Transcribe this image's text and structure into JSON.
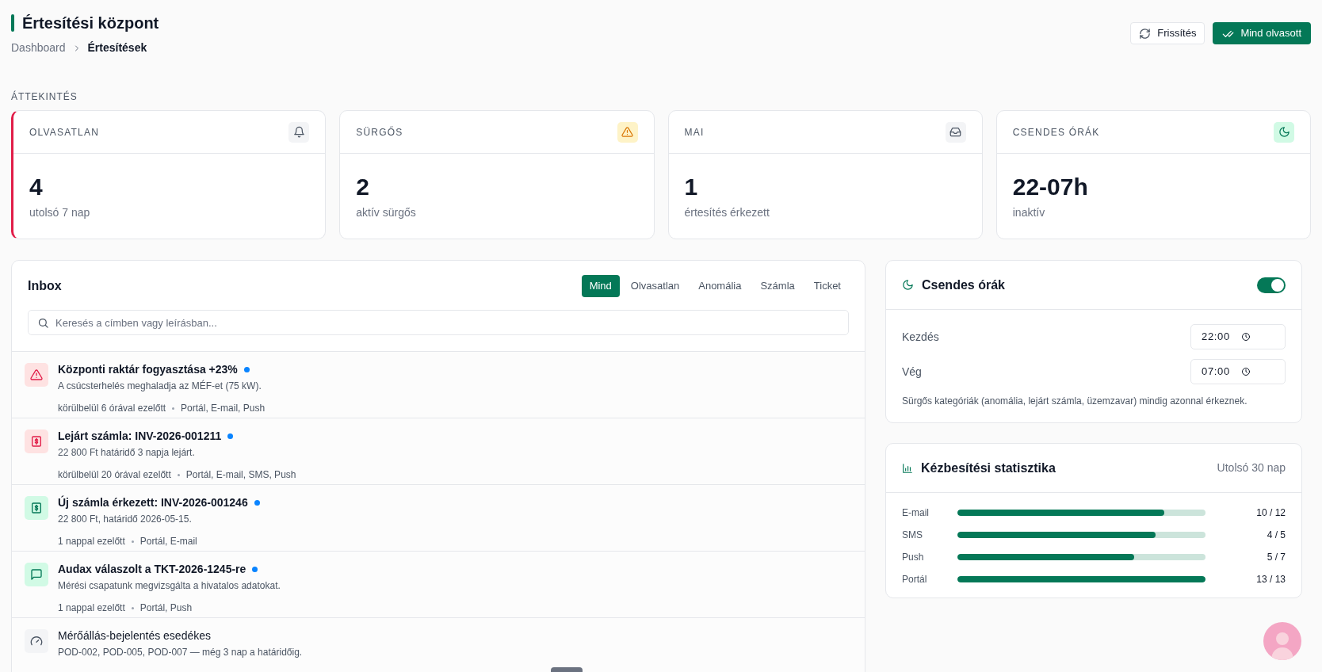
{
  "header": {
    "title": "Értesítési központ",
    "breadcrumb": [
      "Dashboard",
      "Értesítések"
    ],
    "buttons": [
      {
        "label": "Frissítés",
        "kind": "secondary"
      },
      {
        "label": "Mind olvasott",
        "kind": "primary"
      }
    ]
  },
  "overview": {
    "heading": "ÁTTEKINTÉS",
    "cards": [
      {
        "label": "OLVASATLAN",
        "value": "4",
        "caption": "utolsó 7 nap",
        "alert": true
      },
      {
        "label": "SÜRGŐS",
        "value": "2",
        "caption": "aktív sürgős",
        "alert": false
      },
      {
        "label": "MAI",
        "value": "1",
        "caption": "értesítés érkezett",
        "alert": false
      },
      {
        "label": "CSENDES ÓRÁK",
        "value": "22-07h",
        "caption": "inaktív",
        "alert": false
      }
    ]
  },
  "inbox": {
    "title": "Inbox",
    "tabs": [
      {
        "label": "Mind",
        "selected": true
      },
      {
        "label": "Olvasatlan",
        "selected": false
      },
      {
        "label": "Anomália",
        "selected": false
      },
      {
        "label": "Számla",
        "selected": false
      },
      {
        "label": "Ticket",
        "selected": false
      }
    ],
    "search": {
      "placeholder": "Keresés a címben vagy leírásban..."
    },
    "items": [
      {
        "kind": "anomaly",
        "title": "Központi raktár fogyasztása +23%",
        "description": "A csúcsterhelés meghaladja az MÉF-et (75 kW).",
        "time": "körülbelül 6 órával ezelőtt",
        "channels": "Portál, E-mail, Push",
        "unread": true
      },
      {
        "kind": "overdue",
        "title": "Lejárt számla: INV-2026-001211",
        "description": "22 800 Ft határidő 3 napja lejárt.",
        "time": "körülbelül 20 órával ezelőtt",
        "channels": "Portál, E-mail, SMS, Push",
        "unread": true
      },
      {
        "kind": "invoice",
        "title": "Új számla érkezett: INV-2026-001246",
        "description": "22 800 Ft, határidő 2026-05-15.",
        "time": "1 nappal ezelőtt",
        "channels": "Portál, E-mail",
        "unread": true
      },
      {
        "kind": "ticket",
        "title": "Audax válaszolt a TKT-2026-1245-re",
        "description": "Mérési csapatunk megvizsgálta a hivatalos adatokat.",
        "time": "1 nappal ezelőtt",
        "channels": "Portál, Push",
        "unread": true
      },
      {
        "kind": "meter",
        "title": "Mérőállás-bejelentés esedékes",
        "description": "POD-002, POD-005, POD-007 — még 3 nap a határidőig.",
        "unread": false
      }
    ]
  },
  "quiet_hours": {
    "title": "Csendes órák",
    "on": true,
    "fields": [
      {
        "label": "Kezdés",
        "value": "22:00"
      },
      {
        "label": "Vég",
        "value": "07:00"
      }
    ],
    "note": "Sürgős kategóriák (anomália, lejárt számla, üzemzavar) mindig azonnal érkeznek."
  },
  "delivery_stats": {
    "title": "Kézbesítési statisztika",
    "period": "Utolsó 30 nap",
    "rows": [
      {
        "channel": "E-mail",
        "level": 0.833,
        "reading": "10 / 12"
      },
      {
        "channel": "SMS",
        "level": 0.8,
        "reading": "4 / 5"
      },
      {
        "channel": "Push",
        "level": 0.714,
        "reading": "5 / 7"
      },
      {
        "channel": "Portál",
        "level": 1,
        "reading": "13 / 13"
      }
    ]
  }
}
